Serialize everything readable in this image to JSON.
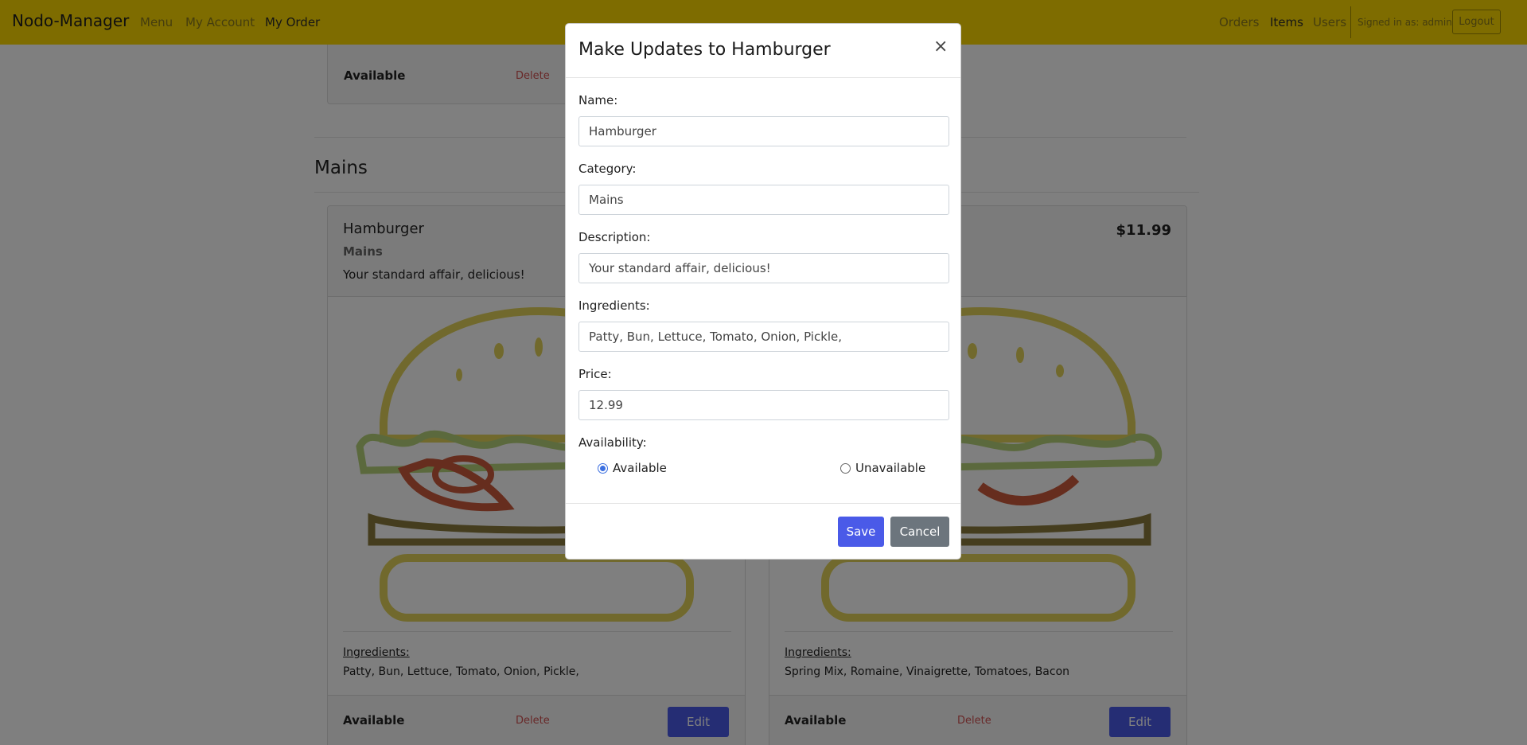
{
  "navbar": {
    "brand": "Nodo-Manager",
    "left_links": [
      "Menu",
      "My Account",
      "My Order"
    ],
    "right_links": [
      "Orders",
      "Items",
      "Users"
    ],
    "signed_in": "Signed in as: admin",
    "logout": "Logout"
  },
  "prev_card": {
    "availability": "Available",
    "delete": "Delete"
  },
  "section": {
    "title": "Mains"
  },
  "cards": [
    {
      "title": "Hamburger",
      "category": "Mains",
      "description": "Your standard affair, delicious!",
      "price": "",
      "ingredients_label": "Ingredients:",
      "ingredients": "Patty, Bun, Lettuce, Tomato, Onion, Pickle,",
      "availability": "Available",
      "delete": "Delete",
      "edit": "Edit"
    },
    {
      "title": "",
      "category": "",
      "description": "",
      "price": "$11.99",
      "ingredients_label": "Ingredients:",
      "ingredients": "Spring Mix, Romaine, Vinaigrette, Tomatoes, Bacon",
      "availability": "Available",
      "delete": "Delete",
      "edit": "Edit"
    }
  ],
  "modal": {
    "title": "Make Updates to Hamburger",
    "close": "×",
    "name_label": "Name:",
    "name_value": "Hamburger",
    "category_label": "Category:",
    "category_value": "Mains",
    "description_label": "Description:",
    "description_value": "Your standard affair, delicious!",
    "ingredients_label": "Ingredients:",
    "ingredients_value": "Patty, Bun, Lettuce, Tomato, Onion, Pickle,",
    "price_label": "Price:",
    "price_value": "12.99",
    "availability_label": "Availability:",
    "option_available": "Available",
    "option_unavailable": "Unavailable",
    "selected": "Available",
    "save": "Save",
    "cancel": "Cancel"
  },
  "colors": {
    "navbar_bg": "#fcd900",
    "primary_button": "#4a5ae8",
    "secondary_button": "#6c757d",
    "delete_text": "#d05050"
  },
  "icons": [
    "close-icon",
    "hamburger-illustration"
  ]
}
